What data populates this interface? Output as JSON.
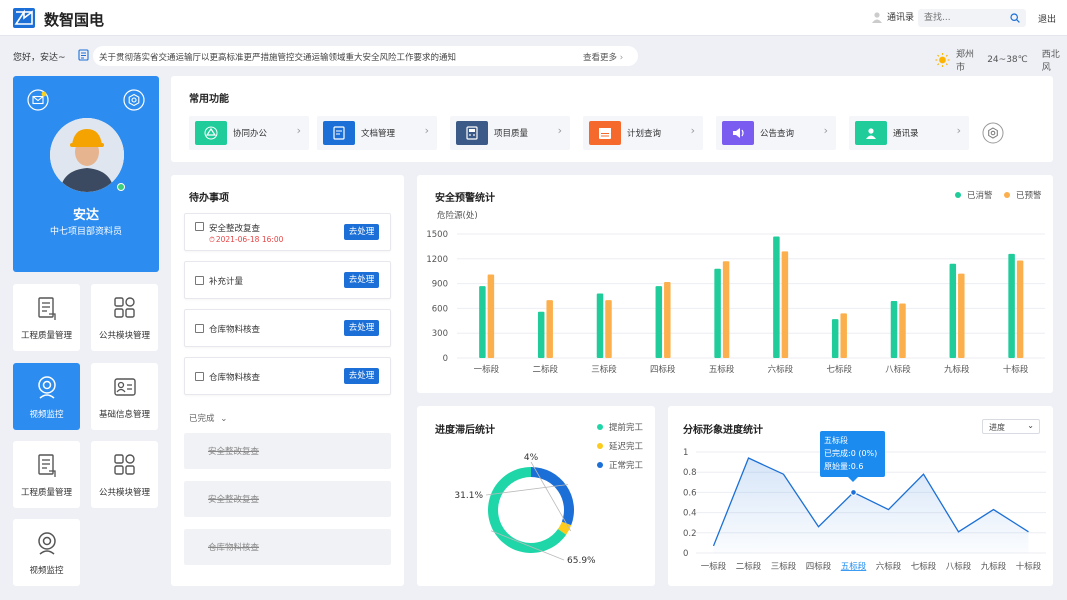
{
  "header": {
    "brand": "数智国电",
    "contacts": "通讯录",
    "search_placeholder": "查找...",
    "logout": "退出"
  },
  "notice": {
    "greeting": "您好，安达~",
    "text": "关于贯彻落实省交通运输厅以更高标准更严措施管控交通运输领域重大安全风险工作要求的通知",
    "more": "查看更多"
  },
  "weather": {
    "city": "郑州市",
    "temp": "24~38℃",
    "wind": "西北风"
  },
  "profile": {
    "name": "安达",
    "role": "中七项目部资料员"
  },
  "tiles": [
    {
      "label": "工程质量管理",
      "icon": "document-icon",
      "active": false
    },
    {
      "label": "公共模块管理",
      "icon": "grid-icon",
      "active": false
    },
    {
      "label": "视频监控",
      "icon": "camera-icon",
      "active": true
    },
    {
      "label": "基础信息管理",
      "icon": "id-card-icon",
      "active": false
    },
    {
      "label": "工程质量管理",
      "icon": "document-icon",
      "active": false
    },
    {
      "label": "公共模块管理",
      "icon": "grid-icon",
      "active": false
    },
    {
      "label": "视频监控",
      "icon": "camera-icon",
      "active": false
    }
  ],
  "functions": {
    "title": "常用功能",
    "items": [
      {
        "label": "协同办公",
        "color": "#1fcc9a",
        "icon": "recycle-icon"
      },
      {
        "label": "文档管理",
        "color": "#1b6fd6",
        "icon": "edit-doc-icon"
      },
      {
        "label": "项目质量",
        "color": "#3c5a87",
        "icon": "calculator-icon"
      },
      {
        "label": "计划查询",
        "color": "#f56a2c",
        "icon": "calendar-icon"
      },
      {
        "label": "公告查询",
        "color": "#7a5cf0",
        "icon": "speaker-icon"
      },
      {
        "label": "通讯录",
        "color": "#1fcc9a",
        "icon": "contact-icon"
      }
    ]
  },
  "todos": {
    "title": "待办事项",
    "action": "去处理",
    "items": [
      {
        "title": "安全整改复查",
        "date": "2021-06-18 16:00"
      },
      {
        "title": "补充计量",
        "date": ""
      },
      {
        "title": "仓库物料核查",
        "date": ""
      },
      {
        "title": "仓库物料核查",
        "date": ""
      }
    ],
    "done_label": "已完成",
    "done_items": [
      "安全整改复查",
      "安全整改复查",
      "仓库物料核查"
    ]
  },
  "safety_chart": {
    "title": "安全预警统计",
    "chart_data": {
      "type": "bar",
      "ylabel": "危险源(处)",
      "ylim": [
        0,
        1500
      ],
      "yticks": [
        0,
        300,
        600,
        900,
        1200,
        1500
      ],
      "categories": [
        "一标段",
        "二标段",
        "三标段",
        "四标段",
        "五标段",
        "六标段",
        "七标段",
        "八标段",
        "九标段",
        "十标段"
      ],
      "series": [
        {
          "name": "已消警",
          "color": "#1fcc9a",
          "values": [
            870,
            560,
            780,
            870,
            1080,
            1470,
            470,
            690,
            1140,
            1260
          ]
        },
        {
          "name": "已预警",
          "color": "#fcb04d",
          "values": [
            1010,
            700,
            700,
            920,
            1170,
            1290,
            540,
            660,
            1020,
            1180
          ]
        }
      ],
      "legend": "top-right"
    }
  },
  "delay_chart": {
    "title": "进度滞后统计",
    "chart_data": {
      "type": "pie",
      "labels": [
        "正常完工",
        "延迟完工",
        "提前完工"
      ],
      "values": [
        31.1,
        4,
        65.9
      ],
      "value_labels": [
        "31.1%",
        "4%",
        "65.9%"
      ],
      "colors": [
        "#1b6fd6",
        "#fccb1b",
        "#1fd6a8"
      ],
      "legend_order": [
        "提前完工",
        "延迟完工",
        "正常完工"
      ],
      "legend_colors": [
        "#1fd6a8",
        "#fccb1b",
        "#1b6fd6"
      ]
    }
  },
  "progress_chart": {
    "title": "分标形象进度统计",
    "select": "进度",
    "tooltip": {
      "title": "五标段",
      "line1": "已完成:0 (0%)",
      "line2": "原始量:0.6"
    },
    "chart_data": {
      "type": "area",
      "ylim": [
        0,
        1
      ],
      "yticks": [
        0,
        0.2,
        0.4,
        0.6,
        0.8,
        1
      ],
      "ytick_labels": [
        "0",
        "0.2",
        "0.4",
        "0.6",
        "0.8",
        "1"
      ],
      "categories": [
        "一标段",
        "二标段",
        "三标段",
        "四标段",
        "五标段",
        "六标段",
        "七标段",
        "八标段",
        "九标段",
        "十标段"
      ],
      "values": [
        0.07,
        0.94,
        0.78,
        0.26,
        0.6,
        0.43,
        0.78,
        0.21,
        0.43,
        0.21
      ],
      "highlight_index": 4,
      "color": "#1b6fd6"
    }
  }
}
